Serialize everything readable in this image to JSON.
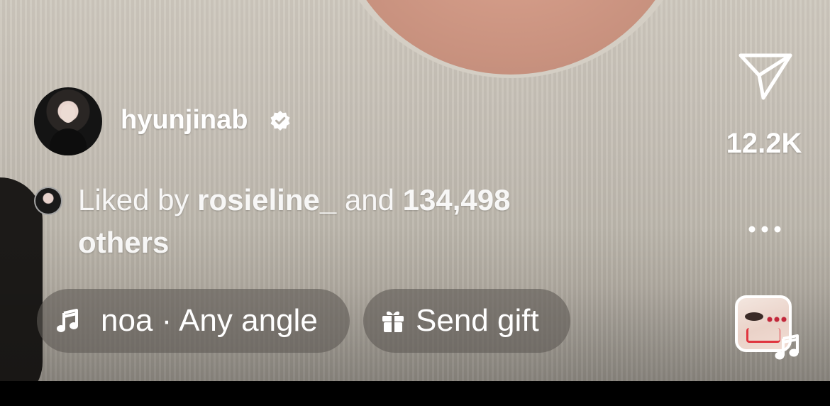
{
  "post": {
    "username": "hyunjinab",
    "verified": true
  },
  "likes": {
    "prefix": "Liked by",
    "liker": "rosieline_",
    "conjunction": "and",
    "count": "134,498",
    "suffix": "others"
  },
  "audio": {
    "label": "noa · Any angle",
    "icon": "music-note-icon"
  },
  "gift": {
    "label": "Send gift",
    "icon": "gift-icon"
  },
  "actions": {
    "share_icon": "paper-plane-icon",
    "share_count": "12.2K",
    "more_icon": "ellipsis-icon"
  },
  "colors": {
    "text": "#ffffff",
    "pill_bg": "rgba(95,90,86,0.62)",
    "thumb_heart": "#c2273a"
  }
}
